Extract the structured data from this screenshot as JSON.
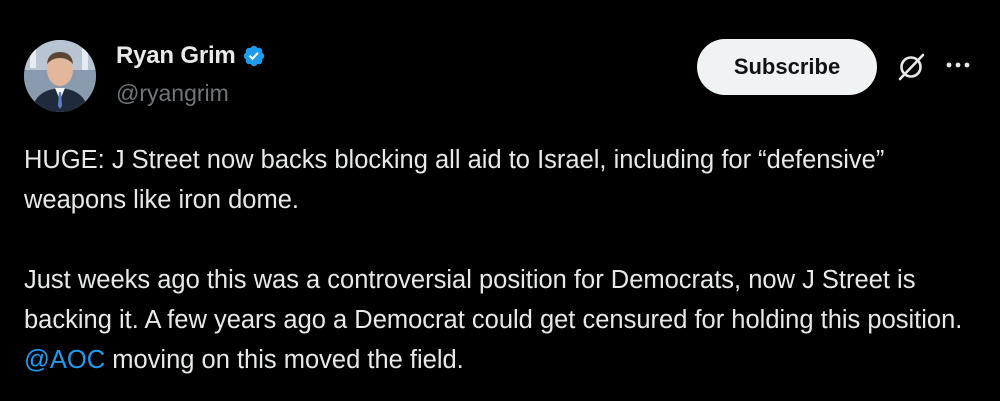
{
  "author": {
    "display_name": "Ryan Grim",
    "handle": "@ryangrim",
    "verified": true
  },
  "actions": {
    "subscribe_label": "Subscribe",
    "grok_icon": "grok-icon",
    "more_icon": "more-horizontal-icon"
  },
  "tweet": {
    "paragraph1": "HUGE: J Street now backs blocking all aid to Israel, including for “defensive” weapons like iron dome.",
    "paragraph2_before": "Just weeks ago this was a controversial position for Democrats, now J Street is backing it. A few years ago a Democrat could get censured for holding this position. ",
    "mention": "@AOC",
    "paragraph2_after": " moving on this moved the field."
  },
  "colors": {
    "background": "#000000",
    "text": "#e7e9ea",
    "secondary": "#71767b",
    "accent": "#1d9bf0",
    "button_bg": "#eff3f4"
  }
}
